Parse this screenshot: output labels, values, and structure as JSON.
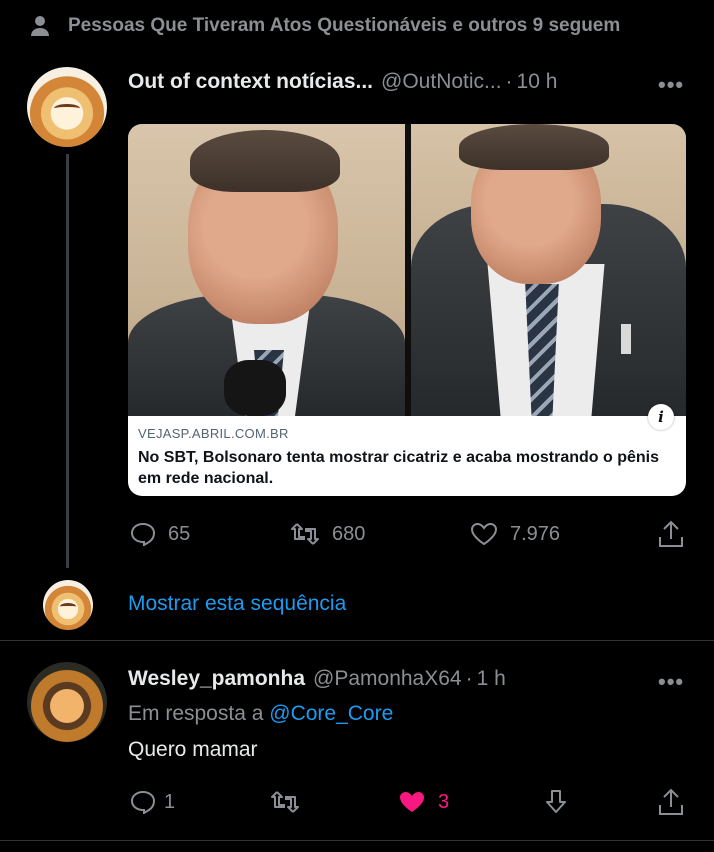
{
  "social_context": {
    "text": "Pessoas Que Tiveram Atos Questionáveis e outros 9 seguem",
    "icon": "person-icon"
  },
  "tweet": {
    "name": "Out of context notícias...",
    "handle": "@OutNotic...",
    "time": "10 h",
    "card": {
      "domain": "VEJASP.ABRIL.COM.BR",
      "title": "No SBT, Bolsonaro tenta mostrar cicatriz e acaba mostrando o pênis em rede nacional.",
      "info_icon": "i"
    },
    "stats": {
      "replies": "65",
      "retweets": "680",
      "likes": "7.976"
    }
  },
  "show_thread": "Mostrar esta sequência",
  "reply": {
    "name": "Wesley_pamonha",
    "handle": "@PamonhaX64",
    "time": "1 h",
    "replying_prefix": "Em resposta a",
    "replying_to": "@Core_Core",
    "text": "Quero mamar",
    "stats": {
      "replies": "1",
      "likes": "3"
    },
    "liked": true
  },
  "separator_dot": "·",
  "more_glyph": "•••",
  "colors": {
    "background": "#000000",
    "accent": "#1d9bf0",
    "like": "#f91880",
    "muted": "#8b8f94"
  }
}
